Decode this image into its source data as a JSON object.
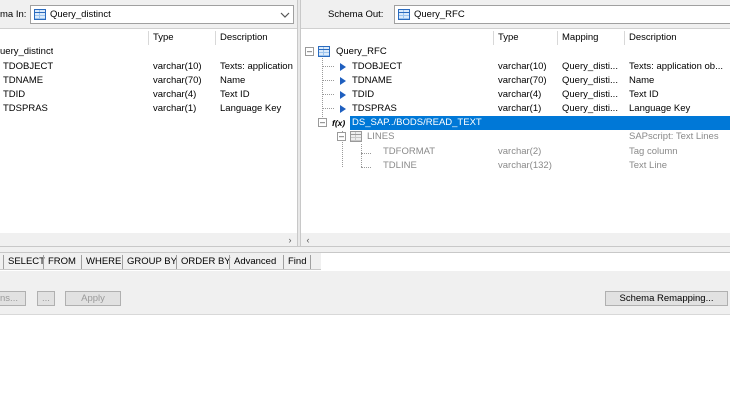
{
  "schema_in": {
    "label": "ma In:",
    "value": "Query_distinct",
    "columns": [
      "Type",
      "Description"
    ],
    "root_label": "uery_distinct",
    "rows": [
      {
        "name": "TDOBJECT",
        "type": "varchar(10)",
        "desc": "Texts: application"
      },
      {
        "name": "TDNAME",
        "type": "varchar(70)",
        "desc": "Name"
      },
      {
        "name": "TDID",
        "type": "varchar(4)",
        "desc": "Text ID"
      },
      {
        "name": "TDSPRAS",
        "type": "varchar(1)",
        "desc": "Language Key"
      }
    ]
  },
  "schema_out": {
    "label": "Schema Out:",
    "value": "Query_RFC",
    "columns": [
      "Type",
      "Mapping",
      "Description"
    ],
    "root_label": "Query_RFC",
    "rows": [
      {
        "name": "TDOBJECT",
        "type": "varchar(10)",
        "mapping": "Query_disti...",
        "desc": "Texts: application ob..."
      },
      {
        "name": "TDNAME",
        "type": "varchar(70)",
        "mapping": "Query_disti...",
        "desc": "Name"
      },
      {
        "name": "TDID",
        "type": "varchar(4)",
        "mapping": "Query_disti...",
        "desc": "Text ID"
      },
      {
        "name": "TDSPRAS",
        "type": "varchar(1)",
        "mapping": "Query_disti...",
        "desc": "Language Key"
      }
    ],
    "function_call": {
      "icon_text": "f(x)",
      "label": "DS_SAP../BODS/READ_TEXT"
    },
    "nested": {
      "name": "LINES",
      "desc": "SAPscript: Text Lines",
      "children": [
        {
          "name": "TDFORMAT",
          "type": "varchar(2)",
          "desc": "Tag column"
        },
        {
          "name": "TDLINE",
          "type": "varchar(132)",
          "desc": "Text Line"
        }
      ]
    }
  },
  "tabs": [
    "SELECT",
    "FROM",
    "WHERE",
    "GROUP BY",
    "ORDER BY",
    "Advanced",
    "Find"
  ],
  "buttons": {
    "ns": "ns...",
    "ellipsis": "...",
    "apply": "Apply",
    "schema_remapping": "Schema Remapping..."
  },
  "colors": {
    "selection": "#0078d7",
    "tree_arrow": "#1f5fbf",
    "disabled_text": "#8a8a8a"
  }
}
